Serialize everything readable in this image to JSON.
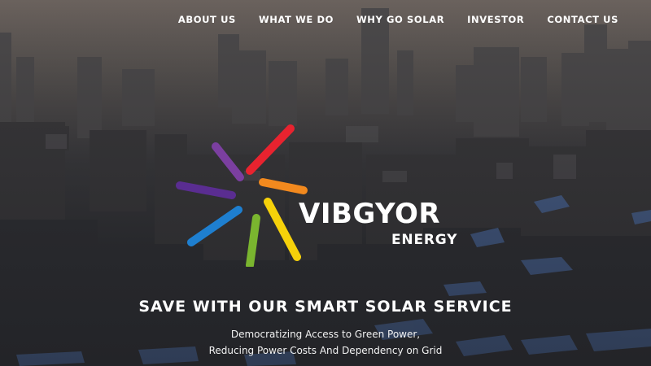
{
  "nav": {
    "items": [
      {
        "label": "ABOUT US"
      },
      {
        "label": "WHAT WE DO"
      },
      {
        "label": "WHY GO SOLAR"
      },
      {
        "label": "INVESTOR"
      },
      {
        "label": "CONTACT US"
      }
    ]
  },
  "brand": {
    "name": "VIBGYOR",
    "sub": "ENERGY",
    "ray_colors": [
      "#e8232f",
      "#f2891e",
      "#f6d10a",
      "#7ab52f",
      "#1e7fd0",
      "#5a2d91",
      "#7b3fa0"
    ]
  },
  "hero": {
    "headline": "SAVE WITH OUR SMART SOLAR SERVICE",
    "subline_1": "Democratizing Access to Green Power,",
    "subline_2": "Reducing Power Costs And Dependency on Grid"
  }
}
